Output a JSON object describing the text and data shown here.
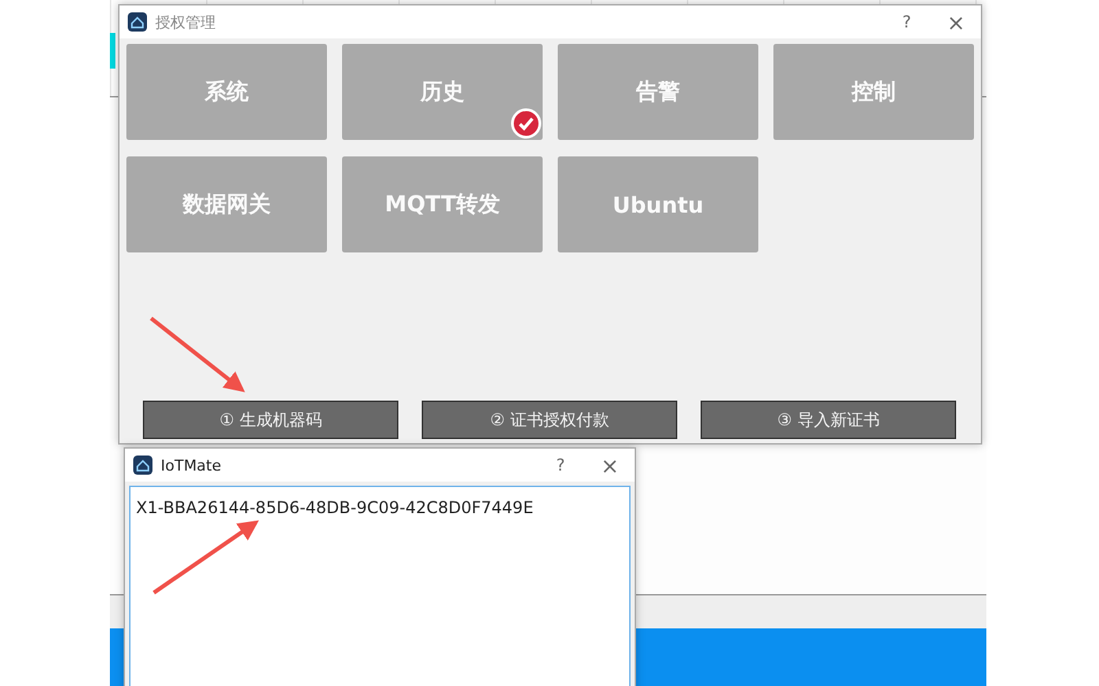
{
  "main_dialog": {
    "title": "授权管理",
    "help": "?",
    "close": "×",
    "modules": [
      {
        "label": "系统",
        "checked": false
      },
      {
        "label": "历史",
        "checked": true
      },
      {
        "label": "告警",
        "checked": false
      },
      {
        "label": "控制",
        "checked": false
      },
      {
        "label": "数据网关",
        "checked": false
      },
      {
        "label": "MQTT转发",
        "checked": false
      },
      {
        "label": "Ubuntu",
        "checked": false
      }
    ],
    "actions": [
      "① 生成机器码",
      "② 证书授权付款",
      "③ 导入新证书"
    ]
  },
  "code_dialog": {
    "title": "IoTMate",
    "help": "?",
    "close": "×",
    "value": "X1-BBA26144-85D6-48DB-9C09-42C8D0F7449E"
  }
}
